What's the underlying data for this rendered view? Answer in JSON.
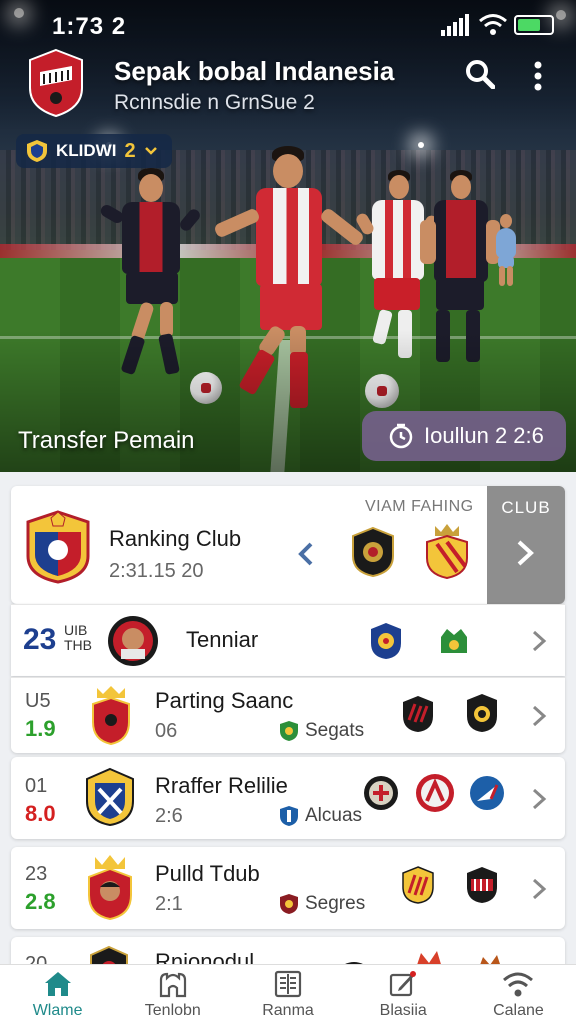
{
  "status_bar": {
    "time": "1:73 2"
  },
  "header": {
    "title": "Sepak bobal Indanesia",
    "subtitle": "Rcnnsdie n GrnSue 2",
    "league_label": "KLIDWI",
    "league_number": "2",
    "icons": [
      "search-icon",
      "more-vert-icon"
    ]
  },
  "hero": {
    "caption": "Transfer Pemain",
    "countdown": "Ioullun 2 2:6"
  },
  "ranking_card": {
    "name": "Ranking Club",
    "time": "2:31.15 20",
    "header_label": "VIAM FAHING",
    "tab_label": "CLUB"
  },
  "rows": [
    {
      "rank_top": "23",
      "rank_mid": "UIB",
      "rank_bot": "THB",
      "name": "Tenniar"
    },
    {
      "rank_a": "U5",
      "rank_b": "1.9",
      "name": "Parting Saanc",
      "sub": "06",
      "tag": "Segats"
    },
    {
      "rank_a": "01",
      "rank_b": "8.0",
      "name": "Rraffer Relilie",
      "sub": "2:6",
      "tag": "Alcuas"
    },
    {
      "rank_a": "23",
      "rank_b": "2.8",
      "name": "Pulld Tdub",
      "sub": "2:1",
      "tag": "Segres"
    },
    {
      "rank_a": "20",
      "name": "Rnionodul"
    }
  ],
  "colors": {
    "green": "#2ca02c",
    "red": "#d42020",
    "accent": "#1f8a8a",
    "navy": "#1d3f8f"
  },
  "tabs": [
    {
      "label": "Wlame",
      "icon": "home-icon",
      "active": true
    },
    {
      "label": "Tenlobn",
      "icon": "stadium-icon",
      "active": false
    },
    {
      "label": "Ranma",
      "icon": "table-icon",
      "active": false
    },
    {
      "label": "Blasiia",
      "icon": "edit-icon",
      "active": false
    },
    {
      "label": "Calane",
      "icon": "wifi-icon",
      "active": false
    }
  ]
}
